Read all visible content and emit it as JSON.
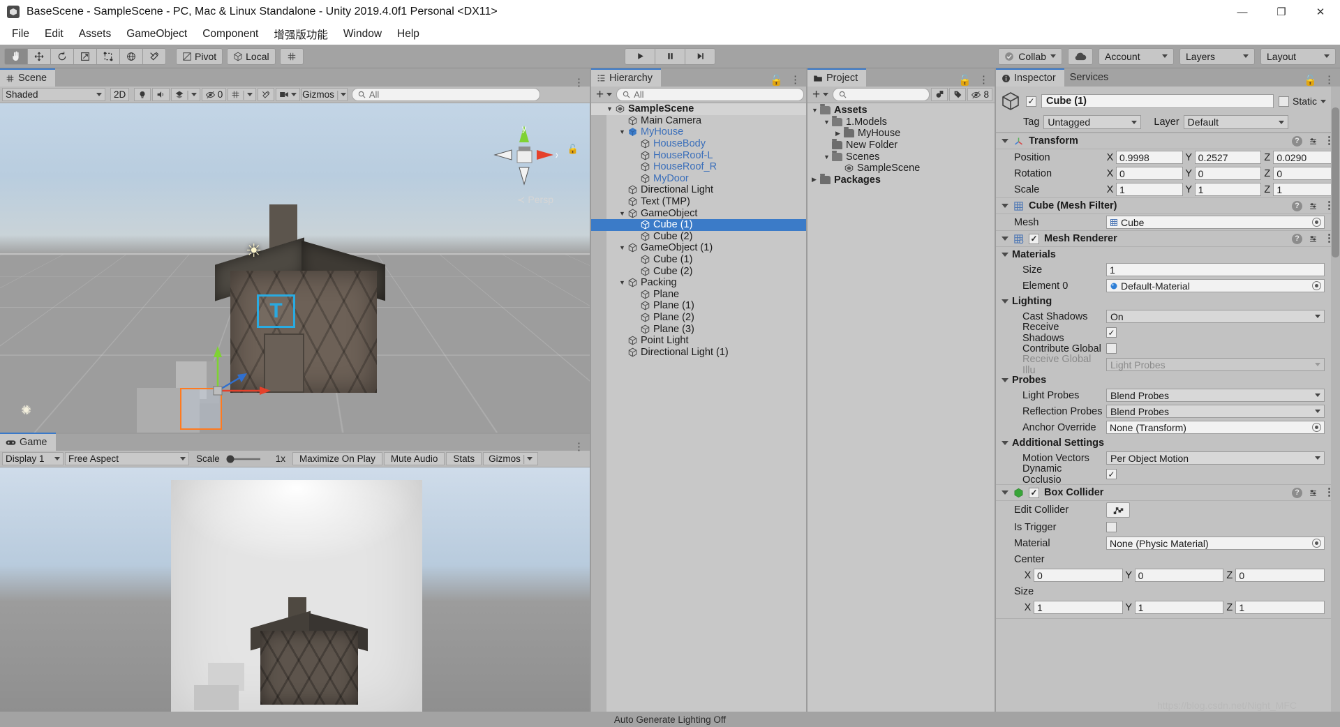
{
  "window": {
    "title": "BaseScene - SampleScene - PC, Mac & Linux Standalone - Unity 2019.4.0f1 Personal <DX11>",
    "minimize": "—",
    "maximize": "❐",
    "close": "✕"
  },
  "menubar": [
    "File",
    "Edit",
    "Assets",
    "GameObject",
    "Component",
    "增强版功能",
    "Window",
    "Help"
  ],
  "toolbar": {
    "tools": [
      "hand-tool",
      "move-tool",
      "rotate-tool",
      "scale-tool",
      "rect-tool",
      "transform-tool",
      "custom-tool"
    ],
    "pivot": "Pivot",
    "handle": "Local",
    "play": "▶",
    "pause": "❙❙",
    "step": "▶❘",
    "collab": "Collab",
    "cloud_icon": "cloud-icon",
    "account": "Account",
    "layers": "Layers",
    "layout": "Layout"
  },
  "scene": {
    "tab": "Scene",
    "shading": "Shaded",
    "mode2d": "2D",
    "lighting_icon": "lighting-icon",
    "audio_icon": "audio-icon",
    "fx_icon": "effects-icon",
    "hidden_count": "0",
    "grid_icon": "grid-icon",
    "tools_icon": "scene-tools-icon",
    "camera_icon": "scene-camera-icon",
    "gizmos": "Gizmos",
    "search_placeholder": "All",
    "axis_y": "y",
    "axis_x": "x",
    "projection": "Persp",
    "tmp_label": "T"
  },
  "game": {
    "tab": "Game",
    "display": "Display 1",
    "aspect": "Free Aspect",
    "scale_label": "Scale",
    "scale_value": "1x",
    "maximize": "Maximize On Play",
    "mute": "Mute Audio",
    "stats": "Stats",
    "gizmos": "Gizmos"
  },
  "hierarchy": {
    "tab": "Hierarchy",
    "add_label": "+",
    "search_placeholder": "All",
    "items": [
      {
        "label": "SampleScene",
        "depth": 0,
        "icon": "unity-scene-icon",
        "expanded": true,
        "root": true,
        "prefab": false,
        "selected": false
      },
      {
        "label": "Main Camera",
        "depth": 1,
        "icon": "gameobject-icon",
        "expanded": null,
        "root": false,
        "prefab": false,
        "selected": false
      },
      {
        "label": "MyHouse",
        "depth": 1,
        "icon": "prefab-icon",
        "expanded": true,
        "root": false,
        "prefab": true,
        "selected": false
      },
      {
        "label": "HouseBody",
        "depth": 2,
        "icon": "gameobject-icon",
        "expanded": null,
        "root": false,
        "prefab": true,
        "selected": false
      },
      {
        "label": "HouseRoof-L",
        "depth": 2,
        "icon": "gameobject-icon",
        "expanded": null,
        "root": false,
        "prefab": true,
        "selected": false
      },
      {
        "label": "HouseRoof_R",
        "depth": 2,
        "icon": "gameobject-icon",
        "expanded": null,
        "root": false,
        "prefab": true,
        "selected": false
      },
      {
        "label": "MyDoor",
        "depth": 2,
        "icon": "gameobject-icon",
        "expanded": null,
        "root": false,
        "prefab": true,
        "selected": false
      },
      {
        "label": "Directional Light",
        "depth": 1,
        "icon": "gameobject-icon",
        "expanded": null,
        "root": false,
        "prefab": false,
        "selected": false
      },
      {
        "label": "Text (TMP)",
        "depth": 1,
        "icon": "gameobject-icon",
        "expanded": null,
        "root": false,
        "prefab": false,
        "selected": false
      },
      {
        "label": "GameObject",
        "depth": 1,
        "icon": "gameobject-icon",
        "expanded": true,
        "root": false,
        "prefab": false,
        "selected": false
      },
      {
        "label": "Cube (1)",
        "depth": 2,
        "icon": "gameobject-icon",
        "expanded": null,
        "root": false,
        "prefab": false,
        "selected": true
      },
      {
        "label": "Cube (2)",
        "depth": 2,
        "icon": "gameobject-icon",
        "expanded": null,
        "root": false,
        "prefab": false,
        "selected": false
      },
      {
        "label": "GameObject (1)",
        "depth": 1,
        "icon": "gameobject-icon",
        "expanded": true,
        "root": false,
        "prefab": false,
        "selected": false
      },
      {
        "label": "Cube (1)",
        "depth": 2,
        "icon": "gameobject-icon",
        "expanded": null,
        "root": false,
        "prefab": false,
        "selected": false
      },
      {
        "label": "Cube (2)",
        "depth": 2,
        "icon": "gameobject-icon",
        "expanded": null,
        "root": false,
        "prefab": false,
        "selected": false
      },
      {
        "label": "Packing",
        "depth": 1,
        "icon": "gameobject-icon",
        "expanded": true,
        "root": false,
        "prefab": false,
        "selected": false
      },
      {
        "label": "Plane",
        "depth": 2,
        "icon": "gameobject-icon",
        "expanded": null,
        "root": false,
        "prefab": false,
        "selected": false
      },
      {
        "label": "Plane (1)",
        "depth": 2,
        "icon": "gameobject-icon",
        "expanded": null,
        "root": false,
        "prefab": false,
        "selected": false
      },
      {
        "label": "Plane (2)",
        "depth": 2,
        "icon": "gameobject-icon",
        "expanded": null,
        "root": false,
        "prefab": false,
        "selected": false
      },
      {
        "label": "Plane (3)",
        "depth": 2,
        "icon": "gameobject-icon",
        "expanded": null,
        "root": false,
        "prefab": false,
        "selected": false
      },
      {
        "label": "Point Light",
        "depth": 1,
        "icon": "gameobject-icon",
        "expanded": null,
        "root": false,
        "prefab": false,
        "selected": false
      },
      {
        "label": "Directional Light (1)",
        "depth": 1,
        "icon": "gameobject-icon",
        "expanded": null,
        "root": false,
        "prefab": false,
        "selected": false
      }
    ]
  },
  "project": {
    "tab": "Project",
    "add_label": "+",
    "search_placeholder": "",
    "hidden_count": "8",
    "items": [
      {
        "label": "Assets",
        "depth": 0,
        "expanded": true,
        "bold": true,
        "icon": "folder-open-icon"
      },
      {
        "label": "1.Models",
        "depth": 1,
        "expanded": true,
        "bold": false,
        "icon": "folder-open-icon"
      },
      {
        "label": "MyHouse",
        "depth": 2,
        "expanded": false,
        "bold": false,
        "icon": "folder-icon"
      },
      {
        "label": "New Folder",
        "depth": 1,
        "expanded": null,
        "bold": false,
        "icon": "folder-icon"
      },
      {
        "label": "Scenes",
        "depth": 1,
        "expanded": true,
        "bold": false,
        "icon": "folder-open-icon"
      },
      {
        "label": "SampleScene",
        "depth": 2,
        "expanded": null,
        "bold": false,
        "icon": "unity-scene-icon"
      },
      {
        "label": "Packages",
        "depth": 0,
        "expanded": false,
        "bold": true,
        "icon": "folder-icon"
      }
    ]
  },
  "inspector": {
    "tab": "Inspector",
    "tab_services": "Services",
    "object_name": "Cube (1)",
    "enabled": true,
    "static_label": "Static",
    "tag_label": "Tag",
    "tag_value": "Untagged",
    "layer_label": "Layer",
    "layer_value": "Default",
    "transform": {
      "title": "Transform",
      "position_label": "Position",
      "position": {
        "x": "0.9998",
        "y": "0.2527",
        "z": "0.0290"
      },
      "rotation_label": "Rotation",
      "rotation": {
        "x": "0",
        "y": "0",
        "z": "0"
      },
      "scale_label": "Scale",
      "scale": {
        "x": "1",
        "y": "1",
        "z": "1"
      }
    },
    "mesh_filter": {
      "title": "Cube (Mesh Filter)",
      "mesh_label": "Mesh",
      "mesh_value": "Cube"
    },
    "mesh_renderer": {
      "title": "Mesh Renderer",
      "enabled": true,
      "materials_label": "Materials",
      "size_label": "Size",
      "size_value": "1",
      "element0_label": "Element 0",
      "element0_value": "Default-Material",
      "lighting_label": "Lighting",
      "cast_shadows_label": "Cast Shadows",
      "cast_shadows_value": "On",
      "receive_shadows_label": "Receive Shadows",
      "receive_shadows_value": true,
      "contribute_global_label": "Contribute Global",
      "contribute_global_value": false,
      "receive_gi_label": "Receive Global Illu",
      "receive_gi_value": "Light Probes",
      "probes_label": "Probes",
      "light_probes_label": "Light Probes",
      "light_probes_value": "Blend Probes",
      "reflection_probes_label": "Reflection Probes",
      "reflection_probes_value": "Blend Probes",
      "anchor_override_label": "Anchor Override",
      "anchor_override_value": "None (Transform)",
      "additional_label": "Additional Settings",
      "motion_vectors_label": "Motion Vectors",
      "motion_vectors_value": "Per Object Motion",
      "dynamic_occlusion_label": "Dynamic Occlusio",
      "dynamic_occlusion_value": true
    },
    "box_collider": {
      "title": "Box Collider",
      "enabled": true,
      "edit_collider_label": "Edit Collider",
      "is_trigger_label": "Is Trigger",
      "is_trigger_value": false,
      "material_label": "Material",
      "material_value": "None (Physic Material)",
      "center_label": "Center",
      "center": {
        "x": "0",
        "y": "0",
        "z": "0"
      },
      "size_label": "Size",
      "size": {
        "x": "1",
        "y": "1",
        "z": "1"
      }
    }
  },
  "statusbar": {
    "text": "Auto Generate Lighting Off",
    "watermark": "https://blog.csdn.net/Night_MFC"
  },
  "colors": {
    "selection_blue": "#3b7bc8",
    "prefab_blue": "#3b6fba",
    "accent_orange": "#ff7a1f",
    "axis_x": "#e5412b",
    "axis_y": "#7fd233",
    "panel_bg": "#c8c8c8",
    "toolbar_bg": "#a3a3a3"
  }
}
